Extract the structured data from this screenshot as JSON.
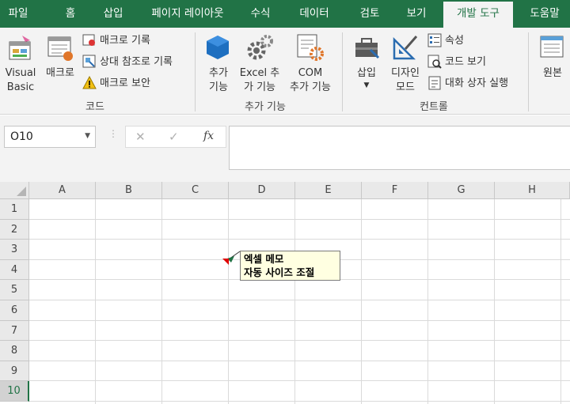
{
  "tabs": [
    {
      "label": "파일"
    },
    {
      "label": "홈"
    },
    {
      "label": "삽입"
    },
    {
      "label": "페이지 레이아웃"
    },
    {
      "label": "수식"
    },
    {
      "label": "데이터"
    },
    {
      "label": "검토"
    },
    {
      "label": "보기"
    },
    {
      "label": "개발 도구",
      "active": true
    },
    {
      "label": "도움말"
    }
  ],
  "ribbon": {
    "code": {
      "visual_basic_1": "Visual",
      "visual_basic_2": "Basic",
      "macro": "매크로",
      "record_macro": "매크로 기록",
      "relative_ref": "상대 참조로 기록",
      "macro_security": "매크로 보안",
      "group": "코드"
    },
    "addins": {
      "addins_1": "추가",
      "addins_2": "기능",
      "excel_addins_1": "Excel 추",
      "excel_addins_2": "가 기능",
      "com_addins_1": "COM",
      "com_addins_2": "추가 기능",
      "group": "추가 기능"
    },
    "controls": {
      "insert": "삽입",
      "design_1": "디자인",
      "design_2": "모드",
      "properties": "속성",
      "view_code": "코드 보기",
      "run_dialog": "대화 상자 실행",
      "group": "컨트롤"
    },
    "xml": {
      "source": "원본"
    }
  },
  "formula_bar": {
    "name_box": "O10",
    "cancel": "✕",
    "enter": "✓",
    "function": "fx",
    "formula": ""
  },
  "sheet": {
    "columns": [
      "A",
      "B",
      "C",
      "D",
      "E",
      "F",
      "G",
      "H"
    ],
    "rows": [
      "1",
      "2",
      "3",
      "4",
      "5",
      "6",
      "7",
      "8",
      "9",
      "10"
    ],
    "selected_row": "10"
  },
  "note": {
    "line1": "엑셀 메모",
    "line2": "자동 사이즈 조절"
  },
  "colors": {
    "accent": "#217346",
    "note_bg": "#ffffe1",
    "comment_marker": "#e00000"
  }
}
